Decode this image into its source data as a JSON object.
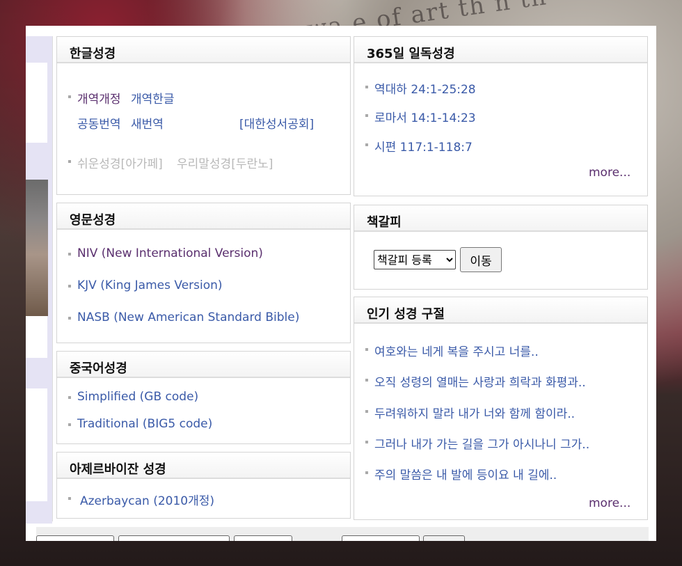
{
  "korean": {
    "title": "한글성경",
    "row1": [
      "개역개정",
      "개역한글"
    ],
    "row2": [
      "공동번역",
      "새번역"
    ],
    "society": "[대한성서공회]",
    "row3": [
      "쉬운성경[아가페]",
      "우리말성경[두란노]"
    ]
  },
  "english": {
    "title": "영문성경",
    "items": [
      "NIV (New International Version)",
      "KJV (King James Version)",
      "NASB (New American Standard Bible)"
    ]
  },
  "chinese": {
    "title": "중국어성경",
    "items": [
      "Simplified (GB code)",
      "Traditional (BIG5 code)"
    ]
  },
  "azeri": {
    "title": "아제르바이잔 성경",
    "items": [
      "Azerbaycan (2010개정)"
    ]
  },
  "daily": {
    "title": "365일 일독성경",
    "items": [
      "역대하 24:1-25:28",
      "로마서 14:1-14:23",
      "시편 117:1-118:7"
    ],
    "more": "more..."
  },
  "bookmark": {
    "title": "책갈피",
    "select_value": "책갈피 등록",
    "button": "이동"
  },
  "popular": {
    "title": "인기 성경 구절",
    "items": [
      "여호와는 네게 복을 주시고 너를..",
      "오직 성령의 열매는 사랑과 희락과 화평과..",
      "두려워하지 말라 내가 너와 함께 함이라..",
      "그러나 내가 가는 길을 그가 아시나니 그가..",
      "주의 말씀은 내 발에 등이요 내 길에.."
    ],
    "more": "more..."
  },
  "colors": {
    "link": "#3a5aa8",
    "visited": "#5a2f6e",
    "disabled": "#b8b8b8",
    "strip": "#e5e3f4"
  }
}
